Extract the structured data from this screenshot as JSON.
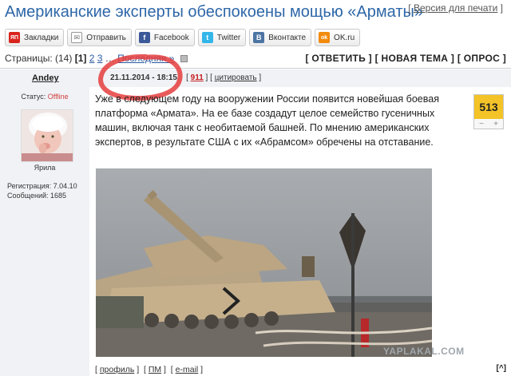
{
  "header": {
    "title": "Американские эксперты обеспокоены мощью «Арматы»",
    "print_link": "Версия для печати"
  },
  "share": [
    {
      "name": "yandex",
      "label": "Закладки",
      "icon": "ЯП",
      "color": "#d9241e"
    },
    {
      "name": "email",
      "label": "Отправить",
      "icon": "✉",
      "color": "#8a8a8a"
    },
    {
      "name": "facebook",
      "label": "Facebook",
      "icon": "f",
      "color": "#3b5998"
    },
    {
      "name": "twitter",
      "label": "Twitter",
      "icon": "t",
      "color": "#33b6ea"
    },
    {
      "name": "vkontakte",
      "label": "Вконтакте",
      "icon": "В",
      "color": "#4c75a3"
    },
    {
      "name": "odnoklassniki",
      "label": "OK.ru",
      "icon": "ok",
      "color": "#f28a0c"
    }
  ],
  "pagination": {
    "label": "Страницы:",
    "count": "(14)",
    "current": "[1]",
    "p2": "2",
    "p3": "3",
    "ellipsis": "…",
    "last": "Последняя »"
  },
  "actions": {
    "reply": "[ ОТВЕТИТЬ ]",
    "new_topic": "[ НОВАЯ ТЕМА ]",
    "poll": "[ ОПРОС ]"
  },
  "post": {
    "author": "Andey",
    "status_label": "Статус:",
    "status_value": "Offline",
    "avatar_label": "Ярила",
    "registration": "Регистрация: 7.04.10",
    "messages": "Сообщений: 1685",
    "date": "21.11.2014 - 18:15",
    "number": "911",
    "quote": "цитировать",
    "text": "Уже в следующем году на вооружении России появится новейшая боевая платформа «Армата». На ее базе создадут целое семейство гусеничных машин, включая танк с необитаемой башней. По мнению американских экспертов, в результате США с их «Абрамсом» обречены на отставание.",
    "rating": "513",
    "rating_minus": "−",
    "rating_plus": "+"
  },
  "watermark": "YAPLAKAL.COM",
  "footer": {
    "profile": "профиль",
    "pm": "ПМ",
    "email": "e-mail",
    "to_top": "[^]"
  }
}
